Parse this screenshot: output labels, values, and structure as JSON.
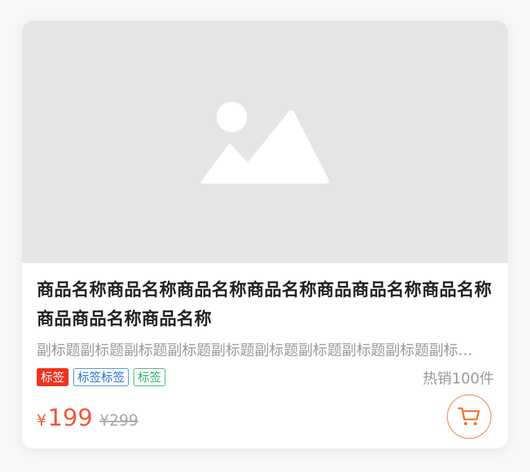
{
  "product": {
    "title": "商品名称商品名称商品名称商品名称商品商品名称商品名称商品商品名称商品名称",
    "subtitle": "副标题副标题副标题副标题副标题副标题副标题副标题副标题副标题副标题",
    "tags": [
      "标签",
      "标签标签",
      "标签"
    ],
    "sales": "热销100件",
    "currency_symbol": "¥",
    "price": "199",
    "original_price": "¥299"
  },
  "image": {
    "placeholder_icon": "image-placeholder-icon"
  },
  "cart": {
    "icon": "cart-icon"
  },
  "colors": {
    "price": "#f05a37",
    "tag_red": "#f0321e",
    "tag_blue": "#1f73d8",
    "tag_green": "#2bb467",
    "cart_accent": "#f07332"
  }
}
